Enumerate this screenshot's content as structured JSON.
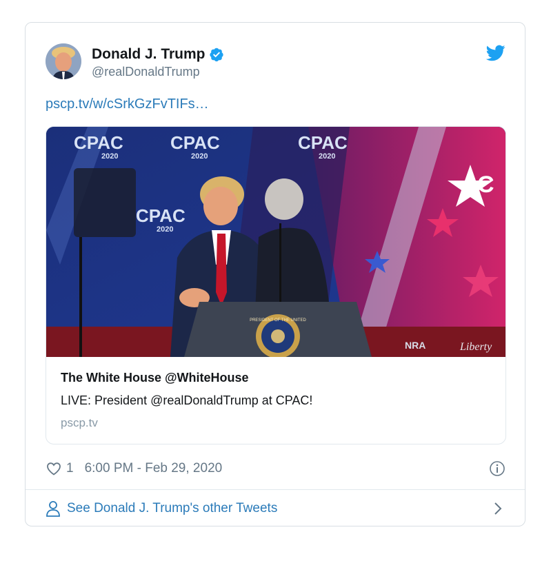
{
  "author": {
    "name": "Donald J. Trump",
    "handle": "@realDonaldTrump",
    "verified": true,
    "avatar_icon": "profile-photo",
    "verified_color": "#1da1f2"
  },
  "brand": {
    "icon": "twitter-bird-icon",
    "color": "#1da1f2"
  },
  "tweet": {
    "link_text": "pscp.tv/w/cSrkGzFvTIFs…"
  },
  "media_card": {
    "title": "The White House @WhiteHouse",
    "description": "LIVE: President @realDonaldTrump at CPAC!",
    "domain": "pscp.tv",
    "image_logos": {
      "cpac_label": "CPAC",
      "cpac_year": "2020",
      "nra_label": "NRA",
      "liberty_label": "Liberty",
      "seal_label": "PRESIDENT OF THE UNITED"
    }
  },
  "meta": {
    "like_count": "1",
    "timestamp": "6:00 PM - Feb 29, 2020"
  },
  "footer": {
    "link_text": "See Donald J. Trump's other Tweets"
  },
  "colors": {
    "link": "#2b7bb9",
    "muted": "#657786",
    "border": "#e1e8ed"
  }
}
